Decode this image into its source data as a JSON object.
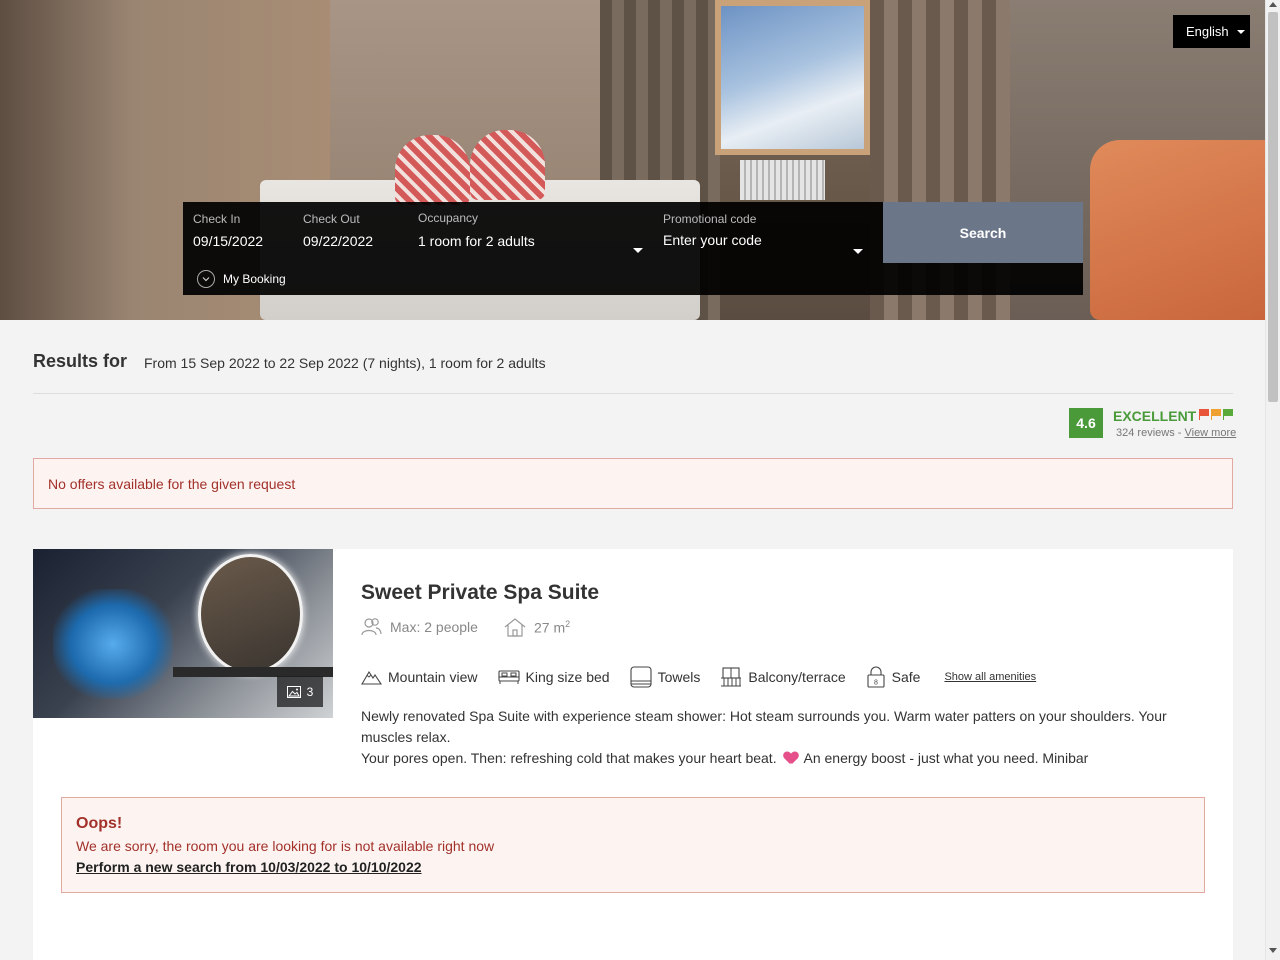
{
  "language": {
    "label": "English"
  },
  "search": {
    "check_in_label": "Check In",
    "check_in_value": "09/15/2022",
    "check_out_label": "Check Out",
    "check_out_value": "09/22/2022",
    "occupancy_label": "Occupancy",
    "occupancy_value": "1 room for 2 adults",
    "promo_label": "Promotional code",
    "promo_placeholder": "Enter your code",
    "search_button": "Search",
    "my_booking": "My Booking"
  },
  "results": {
    "title": "Results for",
    "summary": "From 15 Sep 2022 to 22 Sep 2022 (7 nights), 1 room for 2 adults"
  },
  "rating": {
    "score": "4.6",
    "label": "EXCELLENT",
    "reviews_count": "324 reviews - ",
    "view_more": "View more",
    "colors": [
      "#e8553a",
      "#f0a030",
      "#5aaa3a"
    ]
  },
  "alert": {
    "message": "No offers available for the given request"
  },
  "room": {
    "image_count": "3",
    "title": "Sweet Private Spa Suite",
    "max_people": "Max: 2 people",
    "size": "27 m",
    "size_unit_sup": "2",
    "amenities": [
      {
        "label": "Mountain view",
        "icon": "mountain-icon"
      },
      {
        "label": "King size bed",
        "icon": "bed-icon"
      },
      {
        "label": "Towels",
        "icon": "towel-icon"
      },
      {
        "label": "Balcony/terrace",
        "icon": "balcony-icon"
      },
      {
        "label": "Safe",
        "icon": "safe-icon"
      }
    ],
    "show_all": "Show all amenities",
    "description_line1": "Newly renovated Spa Suite with experience steam shower: Hot steam surrounds you. Warm water patters on your shoulders. Your muscles relax.",
    "description_line2a": "Your pores open. Then: refreshing cold that makes your heart beat. ",
    "description_line2b": "An energy boost - just what you need. Minibar"
  },
  "unavailable": {
    "title": "Oops!",
    "message": "We are sorry, the room you are looking for is not available right now",
    "link": "Perform a new search from 10/03/2022 to 10/10/2022"
  }
}
